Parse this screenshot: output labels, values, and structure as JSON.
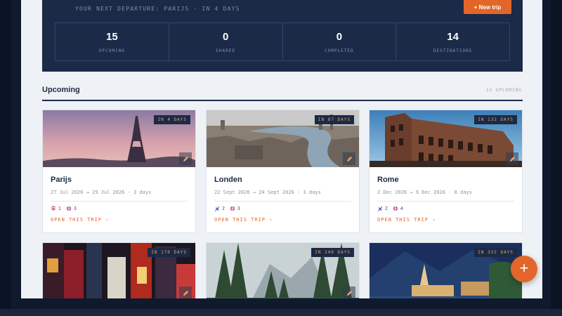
{
  "hero": {
    "departure": "YOUR NEXT DEPARTURE: PARIJS · IN 4 DAYS",
    "new_trip_button": "+ New trip"
  },
  "stats": [
    {
      "value": "15",
      "label": "UPCOMING"
    },
    {
      "value": "0",
      "label": "SHARED"
    },
    {
      "value": "0",
      "label": "COMPLETED"
    },
    {
      "value": "14",
      "label": "DESTINATIONS"
    }
  ],
  "section": {
    "title": "Upcoming",
    "count": "15 UPCOMING"
  },
  "trips": [
    {
      "city": "Parijs",
      "badge": "IN 4 DAYS",
      "dates": "27 Jul 2026 → 29 Jul 2026 · 3 days",
      "meta1_icon": "train-icon",
      "meta1_count": "1",
      "meta2_count": "3",
      "open_label": "OPEN THIS TRIP ›"
    },
    {
      "city": "Londen",
      "badge": "IN 87 DAYS",
      "dates": "22 Sept 2026 → 24 Sept 2026 · 3 days",
      "meta1_icon": "plane-icon",
      "meta1_count": "2",
      "meta2_count": "3",
      "open_label": "OPEN THIS TRIP ›"
    },
    {
      "city": "Rome",
      "badge": "IN 132 DAYS",
      "dates": "2 Dec 2026 → 9 Dec 2026 · 8 days",
      "meta1_icon": "plane-icon",
      "meta1_count": "2",
      "meta2_count": "4",
      "open_label": "OPEN THIS TRIP ›"
    },
    {
      "badge": "IN 170 DAYS"
    },
    {
      "badge": "IN 249 DAYS"
    },
    {
      "badge": "IN 332 DAYS"
    }
  ],
  "fab_label": "+",
  "colors": {
    "navy": "#1b2a47",
    "accent": "#e2662a",
    "background": "#eef1f5"
  }
}
